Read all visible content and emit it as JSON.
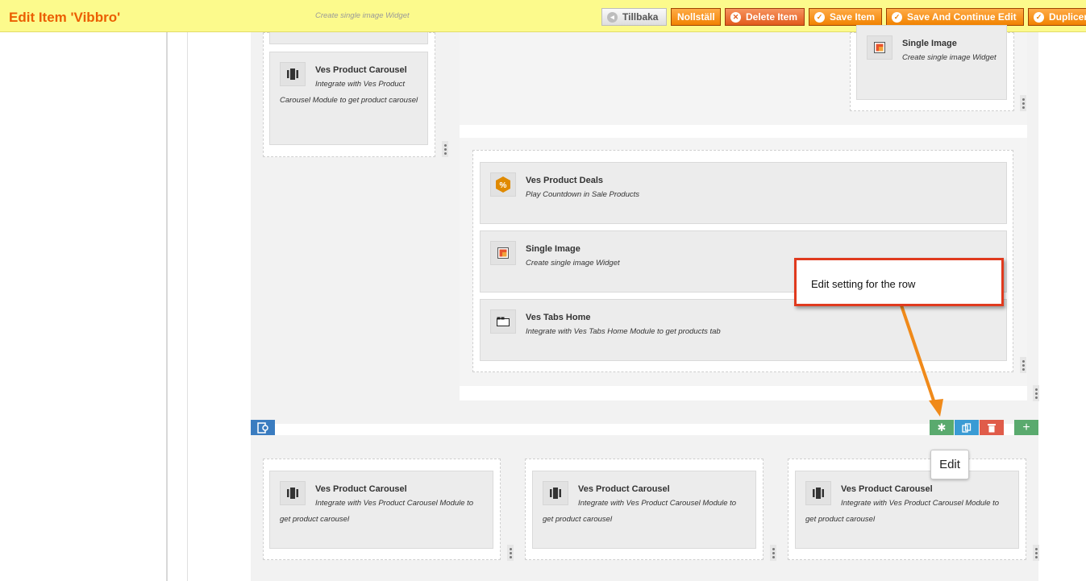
{
  "header": {
    "title": "Edit Item 'Vibbro'",
    "buttons": {
      "back": "Tillbaka",
      "reset": "Nollställ",
      "delete": "Delete Item",
      "save": "Save Item",
      "save_continue": "Save And Continue Edit",
      "duplicate": "Duplicer"
    }
  },
  "widgets": {
    "top_partial_desc": "Create single image Widget",
    "carousel_top": {
      "title": "Ves Product Carousel",
      "desc": "Integrate with Ves Product Carousel Module to get product carousel"
    },
    "single_image_top": {
      "title": "Single Image",
      "desc": "Create single image Widget"
    },
    "deals": {
      "title": "Ves Product Deals",
      "desc": "Play Countdown in Sale Products"
    },
    "single_image_mid": {
      "title": "Single Image",
      "desc": "Create single image Widget"
    },
    "tabs_home": {
      "title": "Ves Tabs Home",
      "desc": "Integrate with Ves Tabs Home Module to get products tab"
    },
    "bottom": [
      {
        "title": "Ves Product Carousel",
        "desc": "Integrate with Ves Product Carousel Module to get product carousel"
      },
      {
        "title": "Ves Product Carousel",
        "desc": "Integrate with Ves Product Carousel Module to get product carousel"
      },
      {
        "title": "Ves Product Carousel",
        "desc": "Integrate with Ves Product Carousel Module to get product carousel"
      }
    ]
  },
  "annotation": {
    "callout": "Edit setting for the row",
    "tooltip": "Edit"
  },
  "icons": {
    "row_settings": "gear-icon",
    "row_duplicate": "copy-icon",
    "row_delete": "trash-icon",
    "row_add": "plus-icon",
    "row_handle": "row-handle-icon"
  },
  "colors": {
    "header_bg": "#fcfa8c",
    "title": "#eb5e00",
    "button_orange": "#f18200",
    "gear_button": "#5aaa6e",
    "copy_button": "#3a9bd4",
    "delete_button": "#e05c4a",
    "callout_border": "#e03a1e",
    "arrow": "#f08a1a"
  }
}
